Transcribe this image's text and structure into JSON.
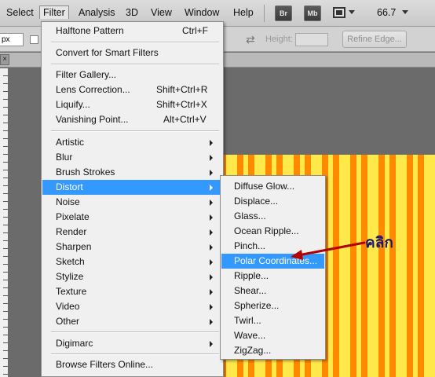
{
  "menubar": {
    "items": [
      {
        "label": "Select",
        "active": false
      },
      {
        "label": "Filter",
        "active": true
      },
      {
        "label": "Analysis",
        "active": false
      },
      {
        "label": "3D",
        "active": false
      },
      {
        "label": "View",
        "active": false
      },
      {
        "label": "Window",
        "active": false
      },
      {
        "label": "Help",
        "active": false
      }
    ],
    "bridge_label": "Br",
    "minibridge_label": "Mb",
    "zoom": "66.7"
  },
  "options": {
    "units_value": "px",
    "height_label": "Height:",
    "height_value": "",
    "refine_edge_label": "Refine Edge..."
  },
  "doc_tab": {
    "close_glyph": "×"
  },
  "filter_menu": {
    "items": [
      {
        "label": "Halftone Pattern",
        "shortcut": "Ctrl+F",
        "submenu": false
      },
      {
        "separator": true
      },
      {
        "label": "Convert for Smart Filters",
        "shortcut": "",
        "submenu": false
      },
      {
        "separator": true
      },
      {
        "label": "Filter Gallery...",
        "shortcut": "",
        "submenu": false
      },
      {
        "label": "Lens Correction...",
        "shortcut": "Shift+Ctrl+R",
        "submenu": false
      },
      {
        "label": "Liquify...",
        "shortcut": "Shift+Ctrl+X",
        "submenu": false
      },
      {
        "label": "Vanishing Point...",
        "shortcut": "Alt+Ctrl+V",
        "submenu": false
      },
      {
        "separator": true
      },
      {
        "label": "Artistic",
        "shortcut": "",
        "submenu": true
      },
      {
        "label": "Blur",
        "shortcut": "",
        "submenu": true
      },
      {
        "label": "Brush Strokes",
        "shortcut": "",
        "submenu": true
      },
      {
        "label": "Distort",
        "shortcut": "",
        "submenu": true,
        "highlighted": true
      },
      {
        "label": "Noise",
        "shortcut": "",
        "submenu": true
      },
      {
        "label": "Pixelate",
        "shortcut": "",
        "submenu": true
      },
      {
        "label": "Render",
        "shortcut": "",
        "submenu": true
      },
      {
        "label": "Sharpen",
        "shortcut": "",
        "submenu": true
      },
      {
        "label": "Sketch",
        "shortcut": "",
        "submenu": true
      },
      {
        "label": "Stylize",
        "shortcut": "",
        "submenu": true
      },
      {
        "label": "Texture",
        "shortcut": "",
        "submenu": true
      },
      {
        "label": "Video",
        "shortcut": "",
        "submenu": true
      },
      {
        "label": "Other",
        "shortcut": "",
        "submenu": true
      },
      {
        "separator": true
      },
      {
        "label": "Digimarc",
        "shortcut": "",
        "submenu": true
      },
      {
        "separator": true
      },
      {
        "label": "Browse Filters Online...",
        "shortcut": "",
        "submenu": false
      }
    ]
  },
  "distort_menu": {
    "items": [
      {
        "label": "Diffuse Glow..."
      },
      {
        "label": "Displace..."
      },
      {
        "label": "Glass..."
      },
      {
        "label": "Ocean Ripple..."
      },
      {
        "label": "Pinch..."
      },
      {
        "label": "Polar Coordinates...",
        "highlighted": true
      },
      {
        "label": "Ripple..."
      },
      {
        "label": "Shear..."
      },
      {
        "label": "Spherize..."
      },
      {
        "label": "Twirl..."
      },
      {
        "label": "Wave..."
      },
      {
        "label": "ZigZag..."
      }
    ]
  },
  "annotation": {
    "text": "คลิก",
    "color": "#b30000"
  },
  "colors": {
    "highlight": "#3399ff",
    "stripe_orange": "#ff8a00",
    "stripe_yellow": "#ffe84a"
  }
}
